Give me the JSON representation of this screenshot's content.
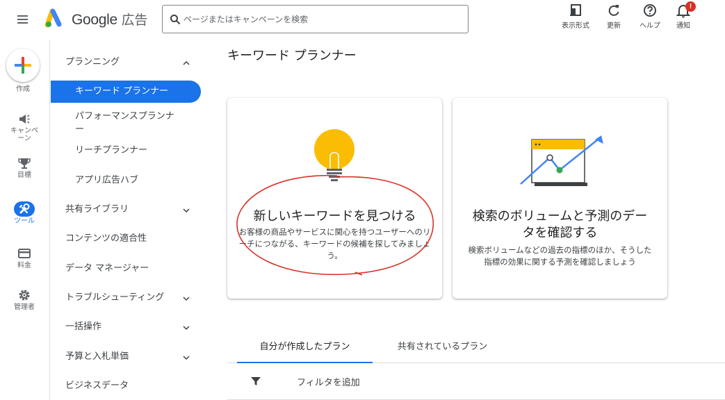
{
  "header": {
    "brand_google": "Google",
    "brand_ads": "広告",
    "search_placeholder": "ページまたはキャンペーンを検索",
    "tools": [
      {
        "label": "表示形式",
        "icon": "appearance-icon"
      },
      {
        "label": "更新",
        "icon": "refresh-icon"
      },
      {
        "label": "ヘルプ",
        "icon": "help-icon"
      },
      {
        "label": "通知",
        "icon": "bell-icon",
        "badge": "!"
      }
    ]
  },
  "rail": {
    "create_label": "作成",
    "items": [
      {
        "label": "キャンペーン",
        "icon": "megaphone-icon"
      },
      {
        "label": "目標",
        "icon": "trophy-icon"
      },
      {
        "label": "ツール",
        "icon": "tools-icon",
        "active": true
      },
      {
        "label": "料金",
        "icon": "billing-icon"
      },
      {
        "label": "管理者",
        "icon": "gear-icon"
      }
    ]
  },
  "nav": {
    "planning": "プランニング",
    "keyword_planner": "キーワード プランナー",
    "performance_planner": "パフォーマンスプランナー",
    "reach_planner": "リーチプランナー",
    "app_ads_hub": "アプリ広告ハブ",
    "shared_library": "共有ライブラリ",
    "content_suitability": "コンテンツの適合性",
    "data_manager": "データ マネージャー",
    "troubleshooting": "トラブルシューティング",
    "bulk_actions": "一括操作",
    "budgets_bids": "予算と入札単価",
    "business_data": "ビジネスデータ"
  },
  "main": {
    "title": "キーワード プランナー",
    "card_discover": {
      "title": "新しいキーワードを見つける",
      "desc": "お客様の商品やサービスに関心を持つユーザーへのリーチにつながる、キーワードの候補を探してみましょう。"
    },
    "card_forecast": {
      "title": "検索のボリュームと予測のデータを確認する",
      "desc": "検索ボリュームなどの過去の指標のほか、そうした指標の効果に関する予測を確認しましょう"
    },
    "tabs": {
      "mine": "自分が作成したプラン",
      "shared": "共有されているプラン"
    },
    "filter_label": "フィルタを追加"
  },
  "colors": {
    "accent": "#1a73e8",
    "bulb": "#fbbc04",
    "annotation": "#d93025"
  }
}
